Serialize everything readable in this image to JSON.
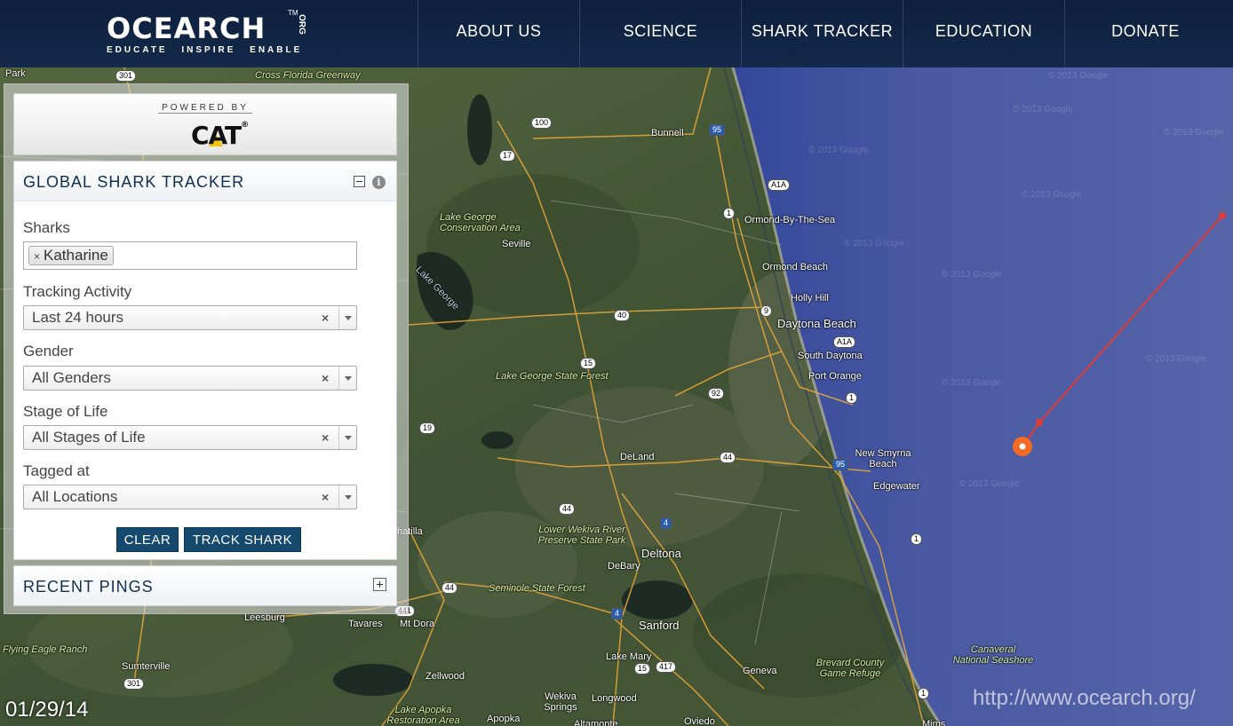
{
  "header": {
    "logo_text": "OCEARCH",
    "logo_org": "ORG",
    "logo_tm": "TM",
    "tagline": "EDUCATE INSPIRE ENABLE",
    "nav": [
      "ABOUT US",
      "SCIENCE",
      "SHARK TRACKER",
      "EDUCATION",
      "DONATE"
    ]
  },
  "panel": {
    "powered_by": "POWERED BY",
    "sponsor": "CAT",
    "sponsor_reg": "®",
    "title": "GLOBAL SHARK TRACKER",
    "sharks_label": "Sharks",
    "selected_shark": "Katharine",
    "chip_remove": "×",
    "tracking_label": "Tracking Activity",
    "tracking_value": "Last 24 hours",
    "gender_label": "Gender",
    "gender_value": "All Genders",
    "stage_label": "Stage of Life",
    "stage_value": "All Stages of Life",
    "tagged_label": "Tagged at",
    "tagged_value": "All Locations",
    "clear_glyph": "×",
    "info_glyph": "i",
    "clear_button": "CLEAR",
    "track_button": "TRACK SHARK",
    "recent_pings": "RECENT PINGS"
  },
  "map": {
    "places": [
      {
        "name": "Park"
      },
      {
        "name": "Cross Florida Greenway"
      },
      {
        "name": "Bunnell"
      },
      {
        "name": "Lake George Conservation Area"
      },
      {
        "name": "Seville"
      },
      {
        "name": "Lake George"
      },
      {
        "name": "Ormond-By-The-Sea"
      },
      {
        "name": "Ormond Beach"
      },
      {
        "name": "Holly Hill"
      },
      {
        "name": "Daytona Beach"
      },
      {
        "name": "South Daytona"
      },
      {
        "name": "Port Orange"
      },
      {
        "name": "Lake George State Forest"
      },
      {
        "name": "DeLand"
      },
      {
        "name": "New Smyrna Beach"
      },
      {
        "name": "Edgewater"
      },
      {
        "name": "Lower Wekiva River Preserve State Park"
      },
      {
        "name": "Deltona"
      },
      {
        "name": "DeBary"
      },
      {
        "name": "Seminole State Forest"
      },
      {
        "name": "Sanford"
      },
      {
        "name": "Lake Mary"
      },
      {
        "name": "Leesburg"
      },
      {
        "name": "Tavares"
      },
      {
        "name": "Mt Dora"
      },
      {
        "name": "Flying Eagle Ranch"
      },
      {
        "name": "Sumterville"
      },
      {
        "name": "Zellwood"
      },
      {
        "name": "Lake Apopka Restoration Area"
      },
      {
        "name": "Apopka"
      },
      {
        "name": "Wekiva Springs"
      },
      {
        "name": "Longwood"
      },
      {
        "name": "Geneva"
      },
      {
        "name": "Brevard County Game Refuge"
      },
      {
        "name": "Canaveral National Seashore"
      },
      {
        "name": "Oviedo"
      },
      {
        "name": "Altamonte"
      },
      {
        "name": "Mims"
      },
      {
        "name": "hatilla"
      }
    ],
    "shields": [
      "301",
      "100",
      "17",
      "95",
      "A1A",
      "1",
      "40",
      "9",
      "A1A",
      "15",
      "1",
      "92",
      "19",
      "44",
      "95",
      "4",
      "44",
      "1",
      "44",
      "441",
      "4",
      "417",
      "15",
      "301",
      "1"
    ],
    "watermark": "© 2013 Google",
    "ping_count": 3
  },
  "stamps": {
    "date": "01/29/14",
    "site": "http://www.ocearch.org/"
  },
  "colors": {
    "header_bg": "#0d1f3c",
    "ocean": "#4a5a9e",
    "track_line": "#e23a35",
    "ping_marker": "#f26a24",
    "button_bg": "#15496e",
    "title_text": "#0f2e52"
  }
}
